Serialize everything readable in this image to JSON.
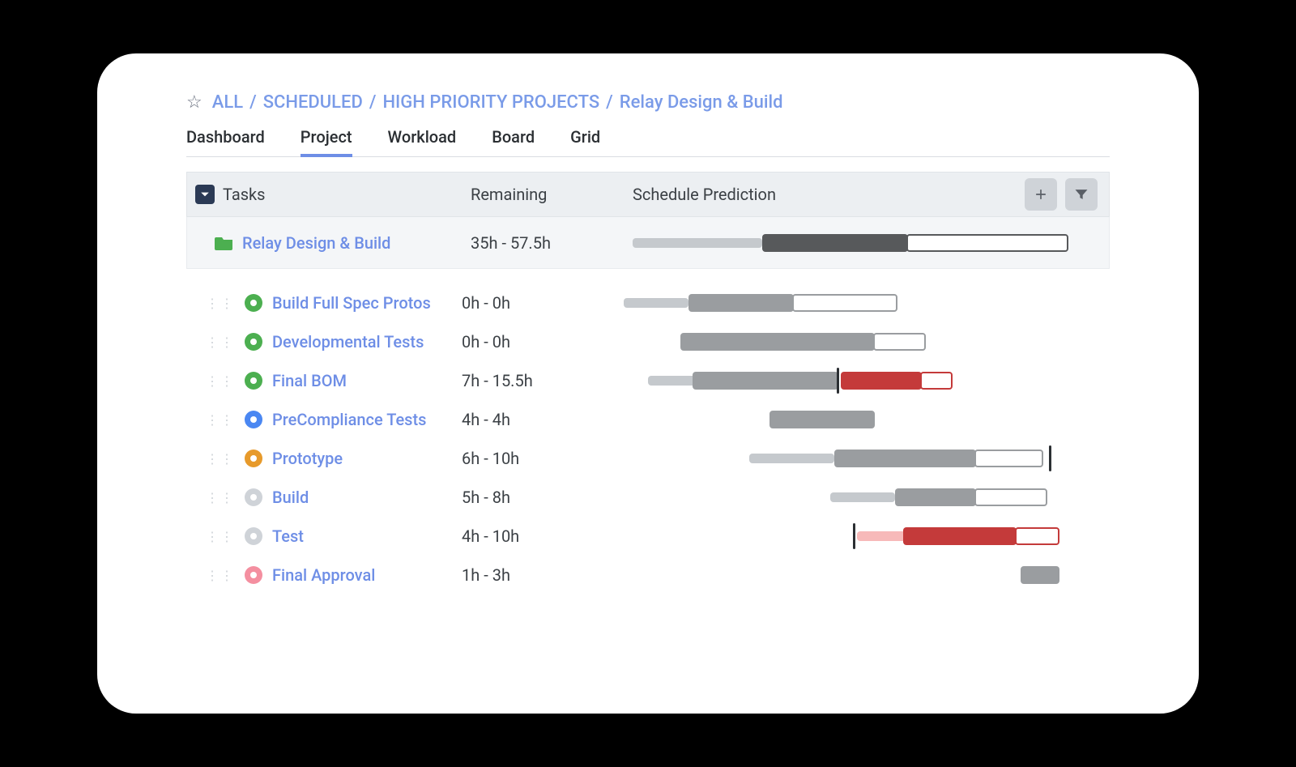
{
  "breadcrumb": {
    "items": [
      "ALL",
      "SCHEDULED",
      "HIGH PRIORITY PROJECTS",
      "Relay Design & Build"
    ]
  },
  "tabs": [
    "Dashboard",
    "Project",
    "Workload",
    "Board",
    "Grid"
  ],
  "active_tab": "Project",
  "columns": {
    "tasks": "Tasks",
    "remaining": "Remaining",
    "schedule": "Schedule Prediction"
  },
  "icons": {
    "add": "plus-icon",
    "filter": "filter-icon"
  },
  "parent": {
    "name": "Relay Design & Build",
    "remaining": "35h - 57.5h"
  },
  "tasks": [
    {
      "name": "Build Full Spec Protos",
      "remaining": "0h - 0h",
      "status": "green"
    },
    {
      "name": "Developmental Tests",
      "remaining": "0h - 0h",
      "status": "green"
    },
    {
      "name": "Final BOM",
      "remaining": "7h - 15.5h",
      "status": "green"
    },
    {
      "name": "PreCompliance Tests",
      "remaining": "4h - 4h",
      "status": "blue"
    },
    {
      "name": "Prototype",
      "remaining": "6h - 10h",
      "status": "orange"
    },
    {
      "name": "Build",
      "remaining": "5h - 8h",
      "status": "gray"
    },
    {
      "name": "Test",
      "remaining": "4h - 10h",
      "status": "gray"
    },
    {
      "name": "Final Approval",
      "remaining": "1h - 3h",
      "status": "pink"
    }
  ]
}
